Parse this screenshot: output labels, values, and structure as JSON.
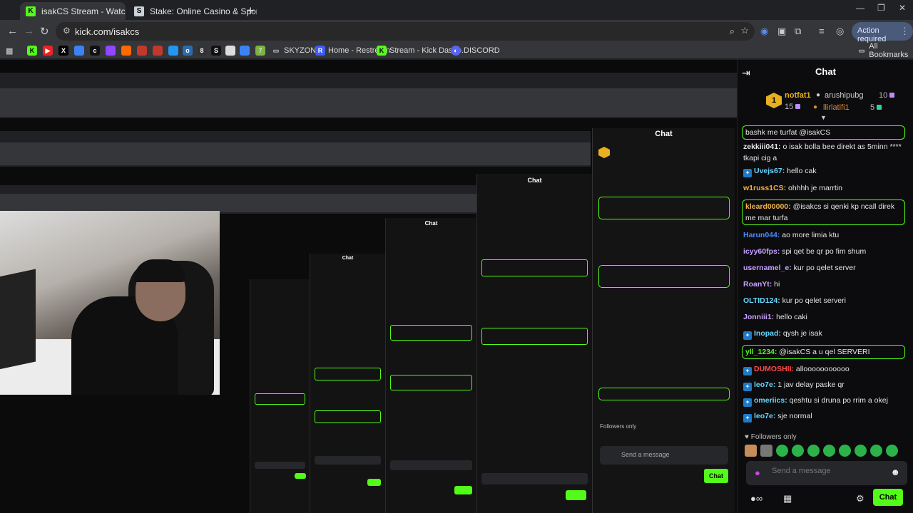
{
  "browser": {
    "tabs": [
      {
        "label": "isakCS Stream - Watch Live on",
        "favicon": "kick-icon",
        "color": "#53fc18"
      },
      {
        "label": "Stake: Online Casino & Sports",
        "favicon": "stake-icon",
        "color": "#c9d1d9"
      }
    ],
    "url": "kick.com/isakcs",
    "action_required": "Action required",
    "bookmarks": [
      {
        "label": "SKYZONE",
        "icon": "folder-icon"
      },
      {
        "label": "Home - Restream",
        "icon": "restream-icon"
      },
      {
        "label": "Stream - Kick Dashb...",
        "icon": "kick-icon"
      },
      {
        "label": "DISCORD",
        "icon": "discord-icon"
      }
    ],
    "all_bookmarks": "All Bookmarks"
  },
  "chat": {
    "title": "Chat",
    "top_gifters": [
      {
        "name": "notfat1",
        "value": "15",
        "rank": "1",
        "color": "#e8b020"
      },
      {
        "name": "arushipubg",
        "value": "10",
        "color": "#cfcfcf"
      },
      {
        "name": "llirlatifi1",
        "value": "5",
        "color": "#d88c3a"
      }
    ],
    "messages": [
      {
        "user": "",
        "text": "bashk me turfat @isakCS",
        "color": "#e5e5e5",
        "highlight": true
      },
      {
        "user": "zekkiii041:",
        "text": "o isak bolla bee direkt as 5minn **** tkapi cig a",
        "color": "#e5e5e5"
      },
      {
        "user": "Uvejs67:",
        "text": "hello cak",
        "color": "#6ad7ff",
        "badge": true
      },
      {
        "user": "w1russ1CS:",
        "text": "ohhhh je marrtin",
        "color": "#f0b24a"
      },
      {
        "user": "kleard00000:",
        "text": "@isakcs si qenki kp ncall direk me mar turfa",
        "color": "#f0b24a",
        "highlight": true
      },
      {
        "user": "Harun044:",
        "text": "ao more limia ktu",
        "color": "#4a8cff"
      },
      {
        "user": "icyy60fps:",
        "text": "spi qet be qr po fim shum",
        "color": "#c8a2ff"
      },
      {
        "user": "usernamel_e:",
        "text": "kur po qelet server",
        "color": "#c8a2ff"
      },
      {
        "user": "RoanYt:",
        "text": "hi",
        "color": "#c8a2ff"
      },
      {
        "user": "OLTID124:",
        "text": "kur po qelet serveri",
        "color": "#6ad7ff"
      },
      {
        "user": "Jonniii1:",
        "text": "hello caki",
        "color": "#c8a2ff"
      },
      {
        "user": "Inopad:",
        "text": "qysh je isak",
        "color": "#6ad7ff",
        "badge": true
      },
      {
        "user": "yll_1234:",
        "text": "@isakCS a u qel SERVERI",
        "color": "#53fc18",
        "highlight": true
      },
      {
        "user": "DUMOSHII:",
        "text": "allooooooooooo",
        "color": "#ff4a4a",
        "badge": true
      },
      {
        "user": "leo7e:",
        "text": "1 jav delay paske qr",
        "color": "#6ad7ff",
        "badge": true
      },
      {
        "user": "omeriics:",
        "text": "qeshtu si druna po rrim a okej",
        "color": "#6ad7ff",
        "badge": true
      },
      {
        "user": "leo7e:",
        "text": "sje normal",
        "color": "#6ad7ff",
        "badge": true
      }
    ],
    "followers_only": "Followers only",
    "send_placeholder": "Send a message",
    "chat_button": "Chat"
  },
  "echo_chat": {
    "title": "Chat",
    "send_placeholder": "Send a message",
    "chat_button": "Chat",
    "followers_only": "Followers only"
  }
}
